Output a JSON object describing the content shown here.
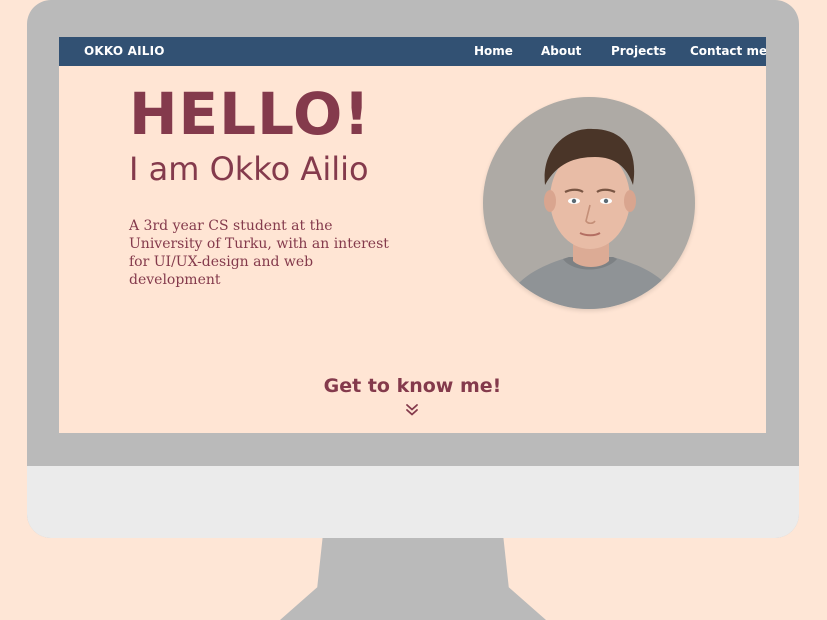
{
  "nav": {
    "brand": "OKKO AILIO",
    "items": [
      {
        "label": "Home"
      },
      {
        "label": "About"
      },
      {
        "label": "Projects"
      },
      {
        "label": "Contact me"
      }
    ]
  },
  "hero": {
    "greeting": "HELLO!",
    "name_line": "I am Okko Ailio",
    "intro": "A 3rd year CS student at the University of Turku, with an interest for UI/UX-design and web development"
  },
  "cta": {
    "label": "Get to know me!",
    "icon": "double-chevron-down-icon"
  },
  "colors": {
    "background": "#fee6d6",
    "navbar": "#325173",
    "accent": "#843a4c",
    "monitor_frame": "#bababa",
    "monitor_chin": "#ebebeb"
  }
}
